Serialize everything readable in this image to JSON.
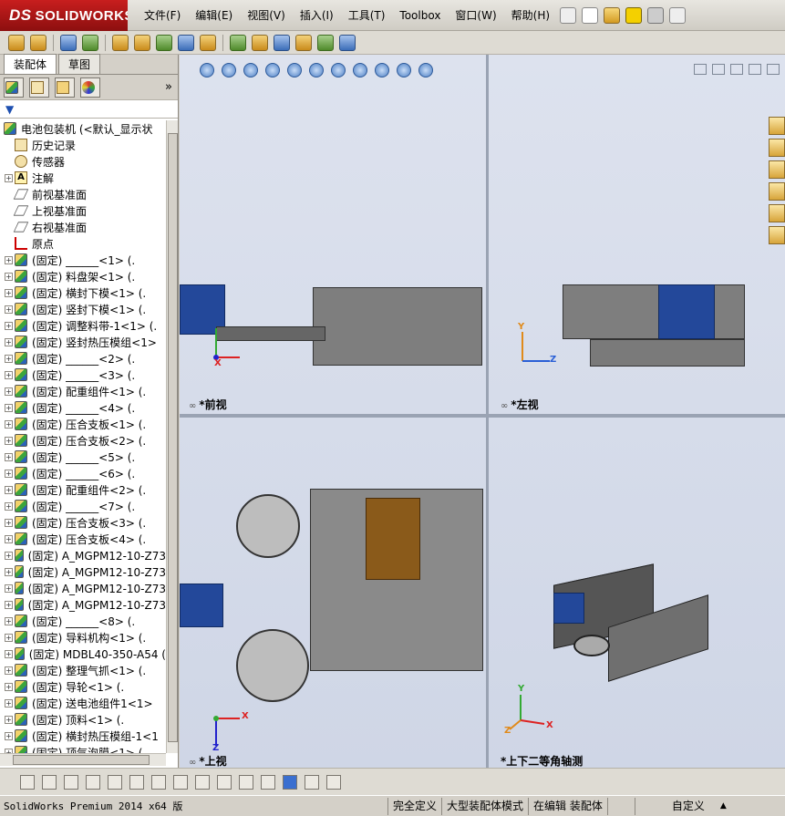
{
  "app": {
    "logo_ds": "DS",
    "logo_name": "SOLIDWORKS"
  },
  "menu": [
    "文件(F)",
    "编辑(E)",
    "视图(V)",
    "插入(I)",
    "工具(T)",
    "Toolbox",
    "窗口(W)",
    "帮助(H)"
  ],
  "panel": {
    "tabs": [
      "装配体",
      "草图"
    ],
    "collapse_glyph": "»",
    "filter_glyph": "▼"
  },
  "tree": {
    "root": "电池包装机  (<默认_显示状",
    "features": [
      {
        "label": "历史记录",
        "icon": "history-icon"
      },
      {
        "label": "传感器",
        "icon": "sensor-icon"
      },
      {
        "label": "注解",
        "icon": "annotation-icon",
        "expandable": true
      },
      {
        "label": "前视基准面",
        "icon": "plane-icon"
      },
      {
        "label": "上视基准面",
        "icon": "plane-icon"
      },
      {
        "label": "右视基准面",
        "icon": "plane-icon"
      },
      {
        "label": "原点",
        "icon": "origin-icon"
      }
    ],
    "components": [
      "(固定) ______<1> (.",
      "(固定) 料盘架<1> (.",
      "(固定) 横封下模<1> (.",
      "(固定) 竖封下模<1> (.",
      "(固定) 调整料带-1<1> (.",
      "(固定) 竖封热压模组<1>",
      "(固定) ______<2> (.",
      "(固定) ______<3> (.",
      "(固定) 配重组件<1> (.",
      "(固定) ______<4> (.",
      "(固定) 压合支板<1> (.",
      "(固定) 压合支板<2> (.",
      "(固定) ______<5> (.",
      "(固定) ______<6> (.",
      "(固定) 配重组件<2> (.",
      "(固定) ______<7> (.",
      "(固定) 压合支板<3> (.",
      "(固定) 压合支板<4> (.",
      "(固定) A_MGPM12-10-Z73",
      "(固定) A_MGPM12-10-Z73",
      "(固定) A_MGPM12-10-Z73",
      "(固定) A_MGPM12-10-Z73",
      "(固定) ______<8> (.",
      "(固定) 导料机构<1> (.",
      "(固定) MDBL40-350-A54 (",
      "(固定) 整理气抓<1> (.",
      "(固定) 导轮<1> (.",
      "(固定) 送电池组件1<1>",
      "(固定) 顶料<1> (.",
      "(固定) 横封热压模组-1<1",
      "(固定) 顶气泡膜<1> (."
    ]
  },
  "views": {
    "front": "*前视",
    "left": "*左视",
    "top": "*上视",
    "iso": "*上下二等角轴测"
  },
  "axes": {
    "x": "X",
    "y": "Y",
    "z": "Z"
  },
  "status": {
    "product": "SolidWorks Premium 2014 x64 版",
    "defined": "完全定义",
    "mode": "大型装配体模式",
    "editing": "在编辑 装配体",
    "custom": "自定义",
    "custom_arrow": "▲"
  },
  "colors": {
    "accent_red": "#c81e1e",
    "viewport_bg": "#d6dceb",
    "assembly_blue": "#23489a"
  }
}
